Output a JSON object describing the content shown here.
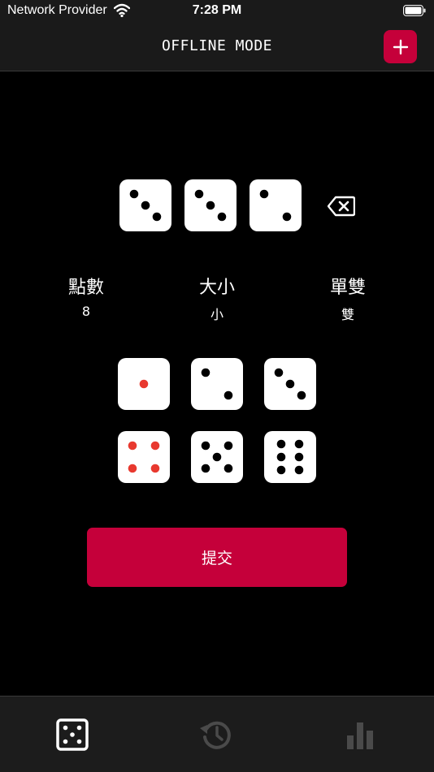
{
  "status_bar": {
    "carrier": "Network Provider",
    "time": "7:28 PM"
  },
  "nav": {
    "title": "OFFLINE MODE",
    "add_icon": "plus-icon"
  },
  "selected_dice": [
    3,
    3,
    2
  ],
  "stats": [
    {
      "label": "點數",
      "value": "8"
    },
    {
      "label": "大小",
      "value": "小"
    },
    {
      "label": "單雙",
      "value": "雙"
    }
  ],
  "dice_picker": [
    1,
    2,
    3,
    4,
    5,
    6
  ],
  "submit_label": "提交",
  "tabs": [
    {
      "name": "dice",
      "icon": "dice-icon",
      "active": true
    },
    {
      "name": "history",
      "icon": "history-icon",
      "active": false
    },
    {
      "name": "stats",
      "icon": "bar-chart-icon",
      "active": false
    }
  ],
  "colors": {
    "accent": "#c5003a",
    "pip_red": "#e8392f",
    "pip_black": "#000000"
  }
}
